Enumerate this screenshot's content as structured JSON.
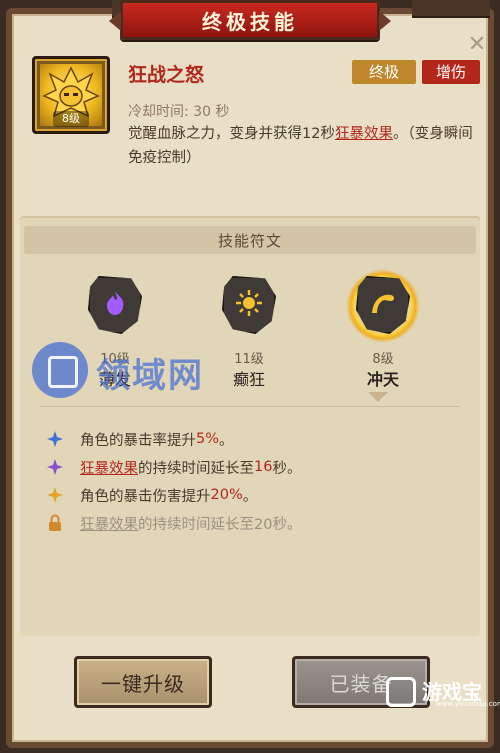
{
  "window": {
    "title": "终极技能"
  },
  "skill": {
    "name": "狂战之怒",
    "level": "8级",
    "tags": [
      "终极",
      "增伤"
    ],
    "cooldown": "冷却时间: 30 秒",
    "desc_prefix": "觉醒血脉之力，变身并获得12秒",
    "desc_link": "狂暴效果",
    "desc_suffix": "。（变身瞬间免疫控制）"
  },
  "runes": {
    "header": "技能符文",
    "items": [
      {
        "level": "10级",
        "name": "薄发",
        "icon": "purple-flame-icon",
        "color": "#a35cff",
        "active": false
      },
      {
        "level": "11级",
        "name": "癫狂",
        "icon": "sun-burst-icon",
        "color": "#f2c230",
        "active": false
      },
      {
        "level": "8级",
        "name": "冲天",
        "icon": "wave-crest-icon",
        "color": "#f2c230",
        "active": true
      }
    ]
  },
  "effects": [
    {
      "icon": "blue-star-icon",
      "color": "#3f6fd4",
      "prefix": "角色的暴击率提升",
      "value": "5%",
      "suffix": "。",
      "locked": false
    },
    {
      "icon": "purple-star-icon",
      "color": "#8a4fd0",
      "link": "狂暴效果",
      "prefix": "的持续时间延长至",
      "value": "16",
      "suffix": "秒。",
      "locked": false
    },
    {
      "icon": "gold-star-icon",
      "color": "#e2a62a",
      "prefix": "角色的暴击伤害提升",
      "value": "20%",
      "suffix": "。",
      "locked": false
    },
    {
      "icon": "lock-icon",
      "color": "#d08a2c",
      "link": "狂暴效果",
      "prefix": "的持续时间延长至20秒。",
      "locked": true
    }
  ],
  "buttons": {
    "upgrade": "一键升级",
    "equipped": "已装备"
  },
  "watermarks": {
    "left": "领域网",
    "right": "游戏宝",
    "right_sub": "www.youxibao.com"
  }
}
